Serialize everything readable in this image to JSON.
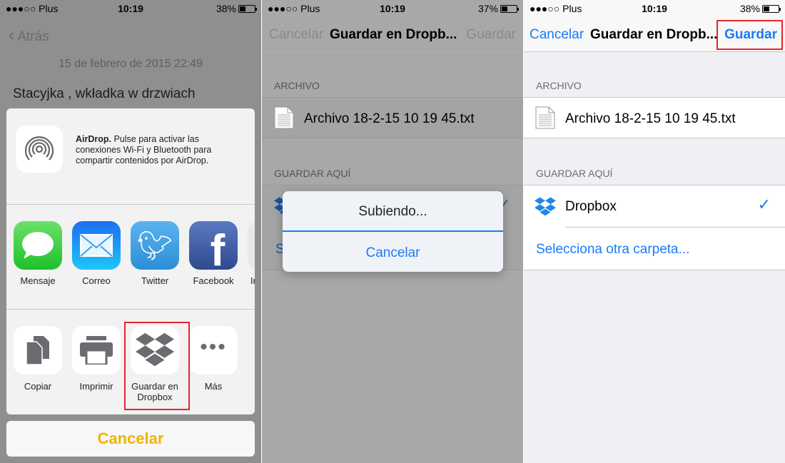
{
  "colors": {
    "accent": "#1a7cf5",
    "cancel_yellow": "#f0b400",
    "highlight": "#e8242b",
    "dropbox": "#1f87e5"
  },
  "panel1": {
    "status": {
      "carrier": "●●●○○ Plus",
      "time": "10:19",
      "battery": "38%",
      "battery_level": 0.38
    },
    "back": "Atrás",
    "date": "15 de febrero de 2015 22:49",
    "note_text": "Stacyjka , wkładka w drzwiach",
    "airdrop": {
      "title": "AirDrop.",
      "text": " Pulse para activar las conexiones Wi-Fi y Bluetooth para compartir contenidos por AirDrop."
    },
    "apps": [
      {
        "label": "Mensaje",
        "icon": "message-icon"
      },
      {
        "label": "Correo",
        "icon": "mail-icon"
      },
      {
        "label": "Twitter",
        "icon": "twitter-icon"
      },
      {
        "label": "Facebook",
        "icon": "facebook-icon"
      },
      {
        "label": "In",
        "icon": "partial-app-icon"
      }
    ],
    "actions": [
      {
        "label": "Copiar",
        "icon": "copy-icon"
      },
      {
        "label": "Imprimir",
        "icon": "print-icon"
      },
      {
        "label": "Guardar en Dropbox",
        "icon": "dropbox-icon",
        "highlighted": true
      },
      {
        "label": "Más",
        "icon": "more-icon"
      }
    ],
    "cancel": "Cancelar"
  },
  "panel2": {
    "status": {
      "carrier": "●●●○○ Plus",
      "time": "10:19",
      "battery": "37%",
      "battery_level": 0.37
    },
    "nav": {
      "cancel": "Cancelar",
      "title": "Guardar en Dropb...",
      "save": "Guardar"
    },
    "archivo_header": "ARCHIVO",
    "file_name": "Archivo 18-2-15 10 19 45.txt",
    "guardar_header": "GUARDAR AQUÍ",
    "partial_link": "S",
    "alert": {
      "title": "Subiendo...",
      "progress": 1.0,
      "cancel": "Cancelar"
    }
  },
  "panel3": {
    "status": {
      "carrier": "●●●○○ Plus",
      "time": "10:19",
      "battery": "38%",
      "battery_level": 0.38
    },
    "nav": {
      "cancel": "Cancelar",
      "title": "Guardar en Dropb...",
      "save": "Guardar"
    },
    "archivo_header": "ARCHIVO",
    "file_name": "Archivo 18-2-15 10 19 45.txt",
    "guardar_header": "GUARDAR AQUÍ",
    "folder": "Dropbox",
    "select_other": "Selecciona otra carpeta..."
  }
}
